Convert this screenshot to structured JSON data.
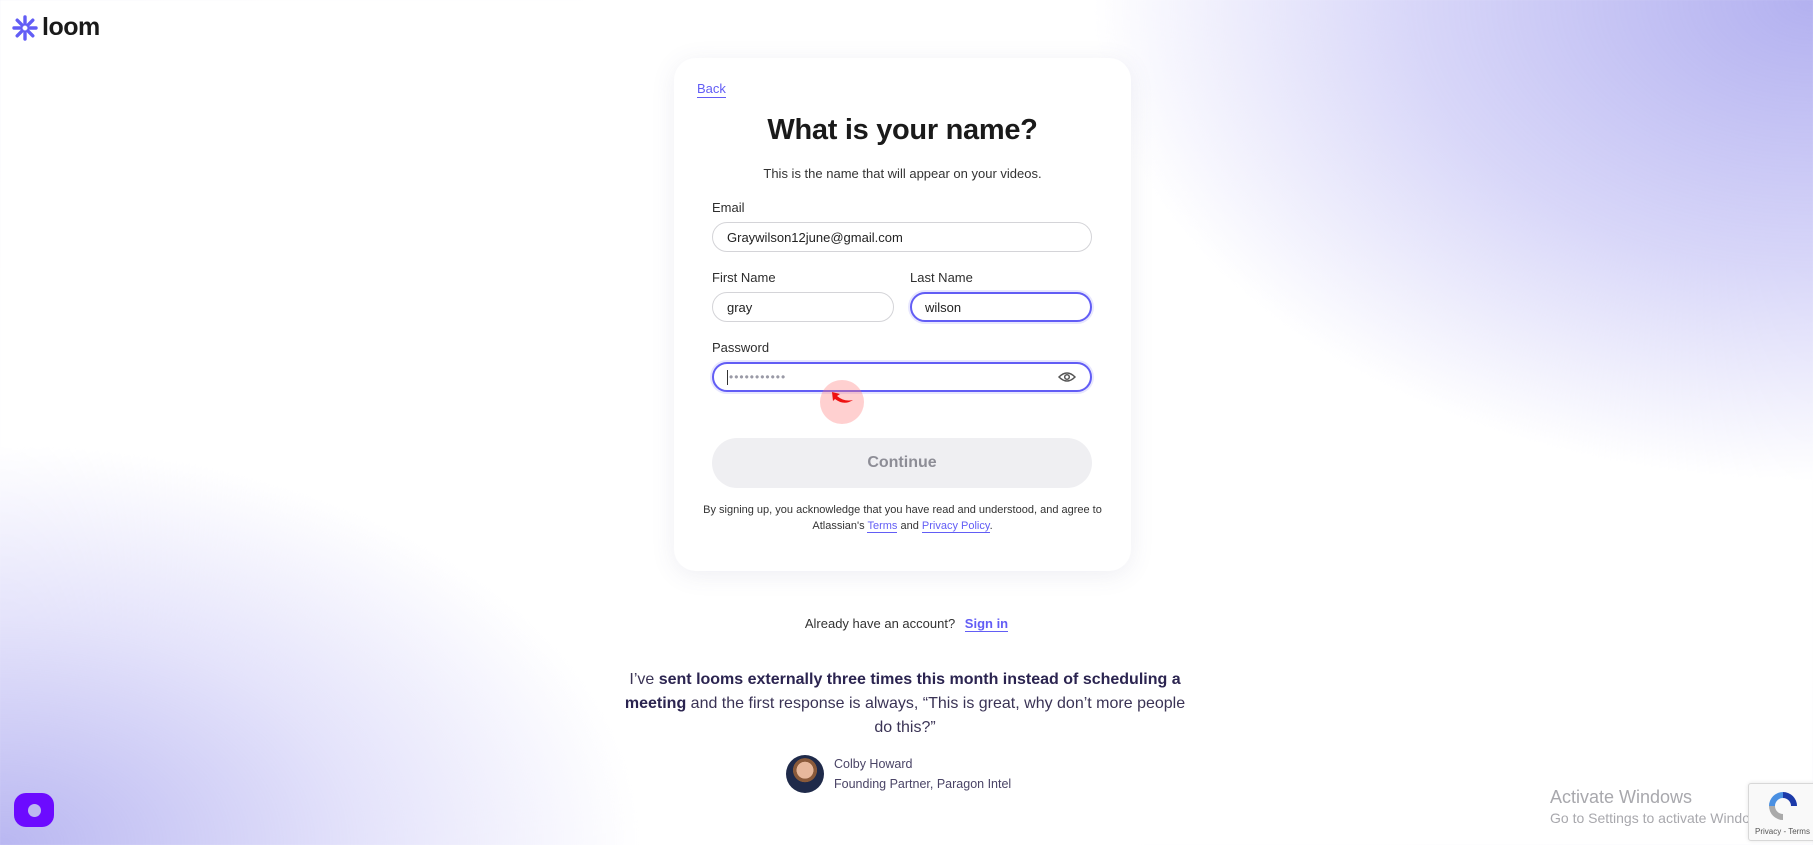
{
  "brand": {
    "name": "loom",
    "accent": "#625df5",
    "logo_color": "#625df5"
  },
  "card": {
    "back_label": "Back",
    "title": "What is your name?",
    "subtitle": "This is the name that will appear on your videos.",
    "email": {
      "label": "Email",
      "value": "Graywilson12june@gmail.com"
    },
    "first_name": {
      "label": "First Name",
      "value": "gray"
    },
    "last_name": {
      "label": "Last Name",
      "value": "wilson"
    },
    "password": {
      "label": "Password",
      "masked_value": "•••••••••••",
      "toggle_icon": "eye-icon"
    },
    "continue_label": "Continue",
    "legal": {
      "prefix": "By signing up, you acknowledge that you have read and understood, and agree to Atlassian's",
      "terms": "Terms",
      "and": "and",
      "privacy": "Privacy Policy",
      "suffix": "."
    }
  },
  "signin": {
    "prompt": "Already have an account?",
    "link": "Sign in"
  },
  "testimonial": {
    "part1": "I’ve ",
    "bold1": "sent looms externally three times this month instead of scheduling a meeting",
    "part2": " and the first response is always, “This is great, why don’t more people do this?”",
    "author_name": "Colby Howard",
    "author_title": "Founding Partner, Paragon Intel"
  },
  "watermark": {
    "line1": "Activate Windows",
    "line2": "Go to Settings to activate Windows."
  },
  "recaptcha": {
    "links": "Privacy - Terms"
  },
  "chat_widget_color": "#6c0bff"
}
